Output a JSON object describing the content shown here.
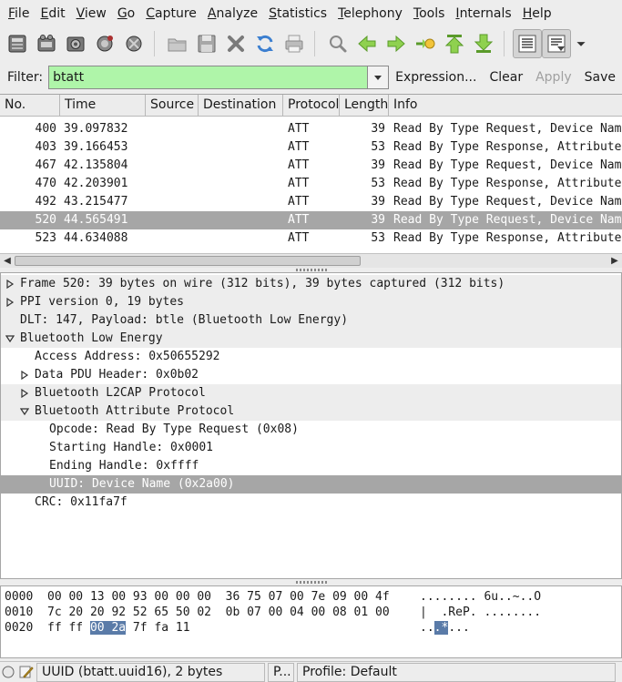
{
  "menu": [
    "File",
    "Edit",
    "View",
    "Go",
    "Capture",
    "Analyze",
    "Statistics",
    "Telephony",
    "Tools",
    "Internals",
    "Help"
  ],
  "toolbar": {
    "icons": [
      "interfaces-icon",
      "capture-options-icon",
      "start-capture-icon",
      "stop-capture-icon",
      "restart-capture-icon",
      "open-file-icon",
      "save-file-icon",
      "close-file-icon",
      "reload-icon",
      "print-icon",
      "find-icon",
      "go-back-icon",
      "go-forward-icon",
      "go-to-packet-icon",
      "first-packet-icon",
      "last-packet-icon",
      "colorize-icon",
      "auto-scroll-icon"
    ]
  },
  "filter": {
    "label": "Filter:",
    "value": "btatt",
    "expression": "Expression...",
    "clear": "Clear",
    "apply": "Apply",
    "save": "Save",
    "input_bg": "#aff5a9"
  },
  "packet_list": {
    "columns": [
      "No.",
      "Time",
      "Source",
      "Destination",
      "Protocol",
      "Length",
      "Info"
    ],
    "selected_index": 5,
    "rows": [
      {
        "no": "400",
        "time": "39.097832",
        "source": "",
        "destination": "",
        "protocol": "ATT",
        "length": "39",
        "info": "Read By Type Request, Device Name"
      },
      {
        "no": "403",
        "time": "39.166453",
        "source": "",
        "destination": "",
        "protocol": "ATT",
        "length": "53",
        "info": "Read By Type Response, Attribute"
      },
      {
        "no": "467",
        "time": "42.135804",
        "source": "",
        "destination": "",
        "protocol": "ATT",
        "length": "39",
        "info": "Read By Type Request, Device Name"
      },
      {
        "no": "470",
        "time": "42.203901",
        "source": "",
        "destination": "",
        "protocol": "ATT",
        "length": "53",
        "info": "Read By Type Response, Attribute"
      },
      {
        "no": "492",
        "time": "43.215477",
        "source": "",
        "destination": "",
        "protocol": "ATT",
        "length": "39",
        "info": "Read By Type Request, Device Name"
      },
      {
        "no": "520",
        "time": "44.565491",
        "source": "",
        "destination": "",
        "protocol": "ATT",
        "length": "39",
        "info": "Read By Type Request, Device Name"
      },
      {
        "no": "523",
        "time": "44.634088",
        "source": "",
        "destination": "",
        "protocol": "ATT",
        "length": "53",
        "info": "Read By Type Response, Attribute"
      }
    ]
  },
  "details": [
    {
      "text": "Frame 520: 39 bytes on wire (312 bits), 39 bytes captured (312 bits)",
      "level": 0,
      "expander": "collapsed",
      "style": "hl"
    },
    {
      "text": "PPI version 0, 19 bytes",
      "level": 0,
      "expander": "collapsed",
      "style": "hl"
    },
    {
      "text": "DLT: 147, Payload: btle (Bluetooth Low Energy)",
      "level": 0,
      "expander": "none",
      "style": "hl"
    },
    {
      "text": "Bluetooth Low Energy",
      "level": 0,
      "expander": "expanded",
      "style": "hl"
    },
    {
      "text": "Access Address: 0x50655292",
      "level": 1,
      "expander": "none",
      "style": ""
    },
    {
      "text": "Data PDU Header: 0x0b02",
      "level": 1,
      "expander": "collapsed",
      "style": ""
    },
    {
      "text": "Bluetooth L2CAP Protocol",
      "level": 1,
      "expander": "collapsed",
      "style": "hl"
    },
    {
      "text": "Bluetooth Attribute Protocol",
      "level": 1,
      "expander": "expanded",
      "style": "hl"
    },
    {
      "text": "Opcode: Read By Type Request (0x08)",
      "level": 2,
      "expander": "none",
      "style": ""
    },
    {
      "text": "Starting Handle: 0x0001",
      "level": 2,
      "expander": "none",
      "style": ""
    },
    {
      "text": "Ending Handle: 0xffff",
      "level": 2,
      "expander": "none",
      "style": ""
    },
    {
      "text": "UUID: Device Name (0x2a00)",
      "level": 2,
      "expander": "none",
      "style": "sel"
    },
    {
      "text": "CRC: 0x11fa7f",
      "level": 1,
      "expander": "none",
      "style": ""
    }
  ],
  "bytes": [
    {
      "offset": "0000",
      "hex_pre": "00 00 13 00 93 00 00 00  36 75 07 00 7e 09 00 4f",
      "hex_hl": "",
      "hex_post": "",
      "ascii_pre": "........ 6u..~..O",
      "ascii_hl": "",
      "ascii_post": ""
    },
    {
      "offset": "0010",
      "hex_pre": "7c 20 20 92 52 65 50 02  0b 07 00 04 00 08 01 00",
      "hex_hl": "",
      "hex_post": "",
      "ascii_pre": "|  .ReP. ........",
      "ascii_hl": "",
      "ascii_post": ""
    },
    {
      "offset": "0020",
      "hex_pre": "ff ff ",
      "hex_hl": "00 2a",
      "hex_post": " 7f fa 11",
      "ascii_pre": "..",
      "ascii_hl": ".*",
      "ascii_post": "..."
    }
  ],
  "status": {
    "field": "UUID (btatt.uuid16), 2 bytes",
    "packets": "P...",
    "profile": "Profile: Default"
  }
}
